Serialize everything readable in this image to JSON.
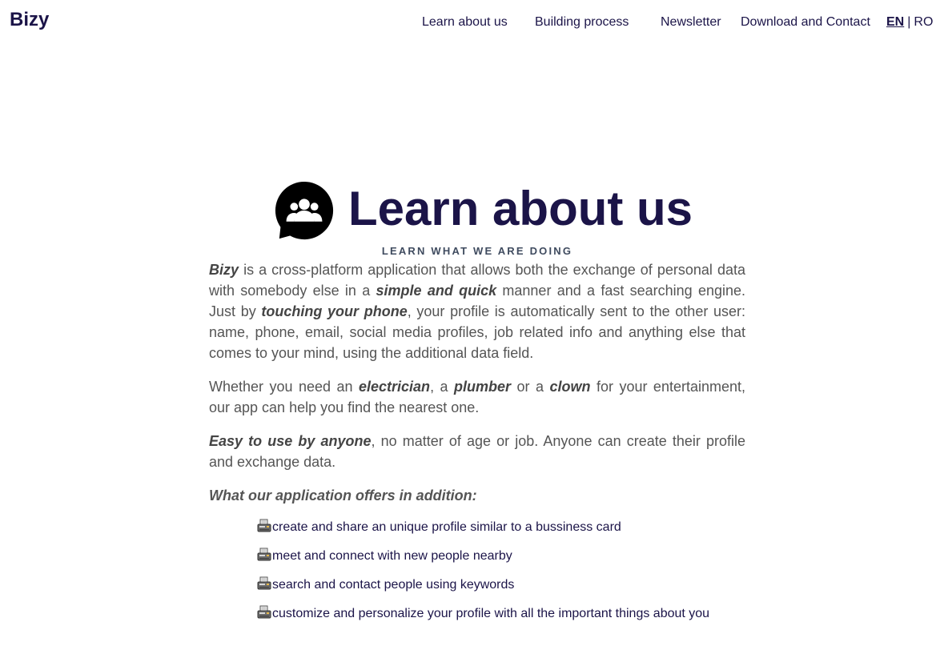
{
  "nav": {
    "brand": "Bizy",
    "links": [
      "Learn about us",
      "Building process",
      "Newsletter",
      "Download and Contact"
    ],
    "lang_active": "EN",
    "lang_sep": "|",
    "lang_other": "RO"
  },
  "section": {
    "icon": "users-chat-icon",
    "title": "Learn about us",
    "subtitle": "LEARN WHAT WE ARE DOING",
    "p1": {
      "t1": "Bizy",
      "t2": " is a cross-platform application that allows both the exchange of personal data with somebody else in a ",
      "t3": "simple and quick",
      "t4": " manner and a fast searching engine. Just by ",
      "t5": "touching your phone",
      "t6": ", your profile is automatically sent to the other user: name, phone, email, social media profiles, job related info and anything else that comes to your mind, using the additional data field."
    },
    "p2": {
      "t1": "Whether you need an ",
      "t2": "electrician",
      "t3": ", a ",
      "t4": "plumber",
      "t5": " or a ",
      "t6": "clown",
      "t7": " for your entertainment, our app can help you find the nearest one."
    },
    "p3": {
      "t1": "Easy to use by anyone",
      "t2": ", no matter of age or job. Anyone can create their profile and exchange data."
    },
    "offers_title": "What our application offers in addition:",
    "feature_icon": "fax-machine-icon",
    "features": [
      "create and share an unique profile similar to a bussiness card",
      "meet and connect with new people nearby",
      "search and contact people using keywords",
      "customize and personalize your profile with all the important things about you"
    ]
  },
  "colors": {
    "brand": "#1b1448",
    "body_text": "#555555",
    "subtitle": "#3f4b5f"
  }
}
